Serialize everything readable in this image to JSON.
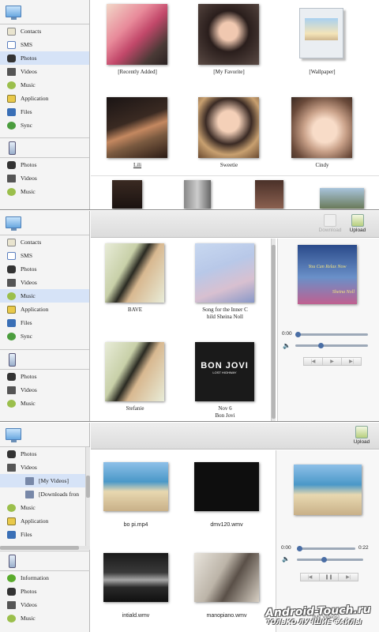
{
  "screen1": {
    "sidebar_pc": [
      "Contacts",
      "SMS",
      "Photos",
      "Videos",
      "Music",
      "Application",
      "Files",
      "Sync"
    ],
    "sidebar_phone": [
      "Photos",
      "Videos",
      "Music"
    ],
    "albums": [
      {
        "label": "[Recently Added]"
      },
      {
        "label": "[My Favorite]"
      },
      {
        "label": "[Wallpaper]"
      },
      {
        "label": "Lili"
      },
      {
        "label": "Sweetie"
      },
      {
        "label": "Cindy"
      }
    ]
  },
  "screen2": {
    "toolbar": {
      "download": "Download",
      "upload": "Upload"
    },
    "sidebar_pc": [
      "Contacts",
      "SMS",
      "Photos",
      "Videos",
      "Music",
      "Application",
      "Files",
      "Sync"
    ],
    "sidebar_phone": [
      "Photos",
      "Videos",
      "Music"
    ],
    "songs": [
      {
        "title": "BAVE",
        "artist": ""
      },
      {
        "title": "Song for the Inner C",
        "artist": "hild  Sheina Noll"
      },
      {
        "title": "Stefanie",
        "artist": ""
      },
      {
        "title": "Nov 6",
        "artist": "Bon Jovi"
      }
    ],
    "player": {
      "cover_text": "You Can Relax Now",
      "cover_artist": "Sheina Noll",
      "time_start": "0:00",
      "progress": 0.0,
      "volume": 0.35
    },
    "bonjovi_text": "BON JOVI",
    "bonjovi_sub": "LOST HIGHWAY"
  },
  "screen3": {
    "toolbar": {
      "upload": "Upload"
    },
    "sidebar_pc": [
      "Photos",
      "Videos"
    ],
    "sidebar_sub": [
      "[My Videos]",
      "[Downloads fron"
    ],
    "sidebar_pc2": [
      "Music",
      "Application",
      "Files"
    ],
    "sidebar_phone": [
      "Information",
      "Photos",
      "Videos",
      "Music"
    ],
    "videos": [
      {
        "name": "bo pi.mp4"
      },
      {
        "name": "dmv120.wmv"
      },
      {
        "name": "intiald.wmv"
      },
      {
        "name": "manopiano.wmv"
      }
    ],
    "player": {
      "time_start": "0:00",
      "time_end": "0:22",
      "progress": 0.0,
      "volume": 0.4,
      "folder": "[My Videos]"
    },
    "watermark": "Android-Touch.ru",
    "watermark_sub": "ТОЛЬКО ЛУЧШИЕ ФАЙЛЫ"
  }
}
